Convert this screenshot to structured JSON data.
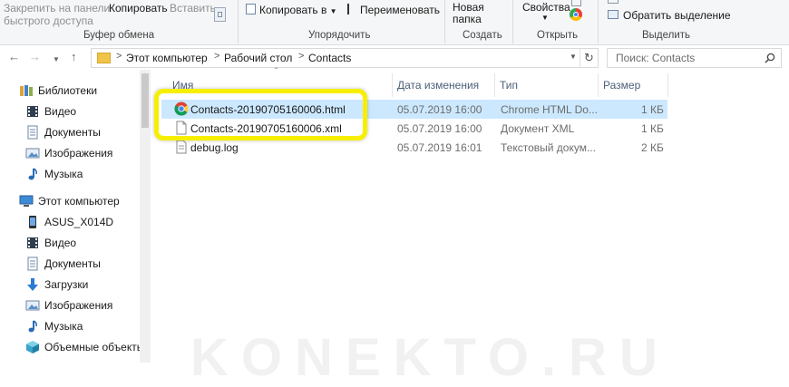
{
  "ribbon": {
    "clipboard": {
      "pin_line1": "Закрепить на панели",
      "pin_line2": "быстрого доступа",
      "copy": "Копировать",
      "paste": "Вставить",
      "label": "Буфер обмена"
    },
    "organize": {
      "copy_to": "Копировать в",
      "rename": "Переименовать",
      "label": "Упорядочить"
    },
    "new": {
      "new_folder_line1": "Новая",
      "new_folder_line2": "папка",
      "label": "Создать"
    },
    "open": {
      "properties": "Свойства",
      "label": "Открыть"
    },
    "select": {
      "invert": "Обратить выделение",
      "label": "Выделить"
    }
  },
  "address": {
    "crumbs": [
      "Этот компьютер",
      "Рабочий стол",
      "Contacts"
    ],
    "search_placeholder": "Поиск: Contacts"
  },
  "nav": {
    "items": [
      {
        "label": "Библиотеки",
        "icon": "libraries-icon"
      },
      {
        "label": "Видео",
        "icon": "video-icon"
      },
      {
        "label": "Документы",
        "icon": "documents-icon"
      },
      {
        "label": "Изображения",
        "icon": "pictures-icon"
      },
      {
        "label": "Музыка",
        "icon": "music-icon"
      },
      {
        "label": "Этот компьютер",
        "icon": "computer-icon"
      },
      {
        "label": "ASUS_X014D",
        "icon": "phone-icon"
      },
      {
        "label": "Видео",
        "icon": "video-icon"
      },
      {
        "label": "Документы",
        "icon": "documents-icon"
      },
      {
        "label": "Загрузки",
        "icon": "downloads-icon"
      },
      {
        "label": "Изображения",
        "icon": "pictures-icon"
      },
      {
        "label": "Музыка",
        "icon": "music-icon"
      },
      {
        "label": "Объемные объекты",
        "icon": "3d-objects-icon"
      }
    ]
  },
  "files": {
    "columns": {
      "name": "Имя",
      "date": "Дата изменения",
      "type": "Тип",
      "size": "Размер"
    },
    "rows": [
      {
        "name": "Contacts-20190705160006.html",
        "date": "05.07.2019 16:00",
        "type": "Chrome HTML Do...",
        "size": "1 КБ",
        "icon": "chrome-icon",
        "selected": true
      },
      {
        "name": "Contacts-20190705160006.xml",
        "date": "05.07.2019 16:00",
        "type": "Документ XML",
        "size": "1 КБ",
        "icon": "xml-file-icon",
        "selected": false
      },
      {
        "name": "debug.log",
        "date": "05.07.2019 16:01",
        "type": "Текстовый докум...",
        "size": "2 КБ",
        "icon": "text-file-icon",
        "selected": false
      }
    ]
  },
  "watermark": "KONEKTO.RU",
  "colors": {
    "highlight": "#f7ef00",
    "selection": "#cce8ff",
    "header_text": "#4c607a"
  }
}
